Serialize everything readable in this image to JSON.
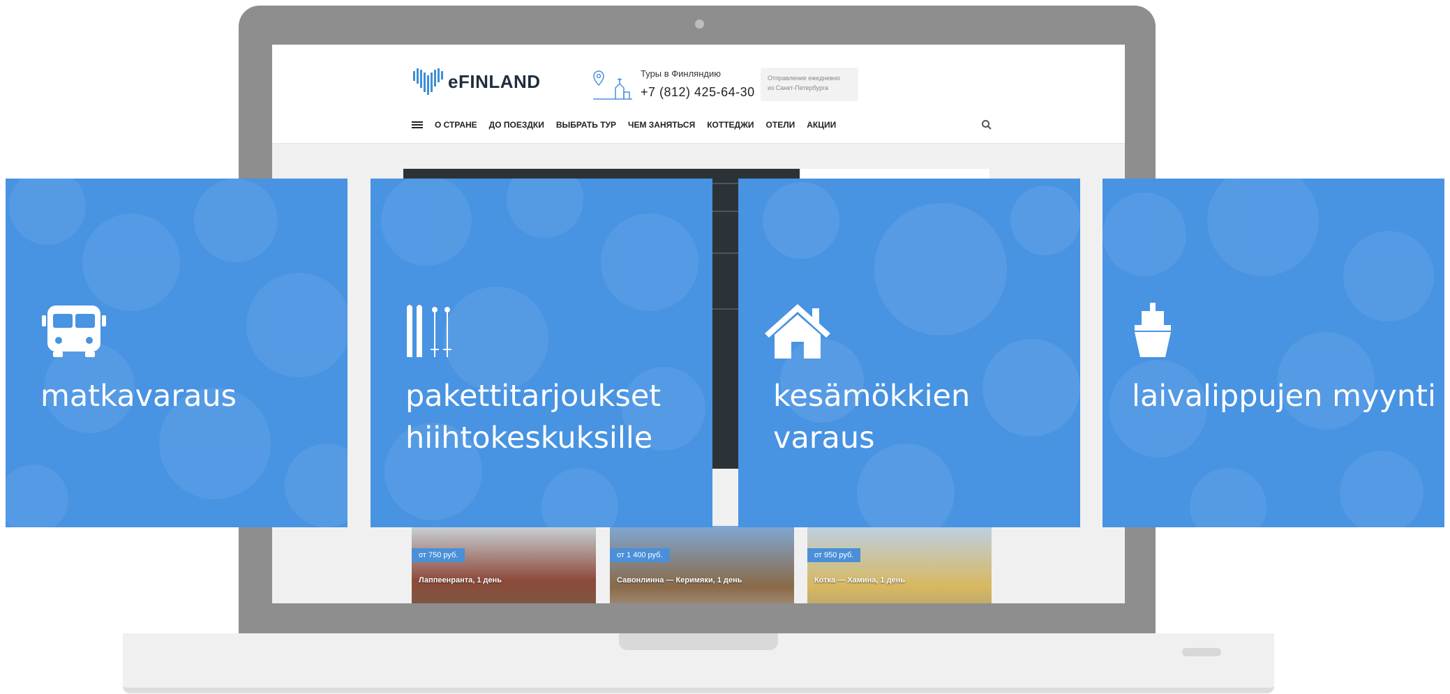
{
  "site": {
    "logo_text": "eFINLAND",
    "tour_label": "Туры в Финляндию",
    "phone": "+7 (812) 425-64-30",
    "departure_line1": "Отправление ежедневно",
    "departure_line2": "из Санкт-Петербурга",
    "nav": [
      "О СТРАНЕ",
      "ДО ПОЕЗДКИ",
      "ВЫБРАТЬ ТУР",
      "ЧЕМ ЗАНЯТЬСЯ",
      "КОТТЕДЖИ",
      "ОТЕЛИ",
      "АКЦИИ"
    ],
    "cards": [
      {
        "price": "от 750 руб.",
        "title": "Лаппеенранта, 1 день"
      },
      {
        "price": "от 1 400 руб.",
        "title": "Савонлинна — Керимяки, 1 день"
      },
      {
        "price": "от 950 руб.",
        "title": "Котка — Хамина, 1 день"
      }
    ]
  },
  "tiles": [
    {
      "label": "matkavaraus",
      "icon": "bus-icon"
    },
    {
      "label": "pakettitarjoukset\nhiihtokeskuksille",
      "icon": "ski-icon"
    },
    {
      "label": "kesämökkien varaus",
      "icon": "house-icon"
    },
    {
      "label": "laivalippujen myynti",
      "icon": "ship-icon"
    }
  ],
  "colors": {
    "tile_blue": "#4893e2",
    "laptop_gray": "#8e8e8e",
    "price_blue": "#4a8fd8"
  }
}
